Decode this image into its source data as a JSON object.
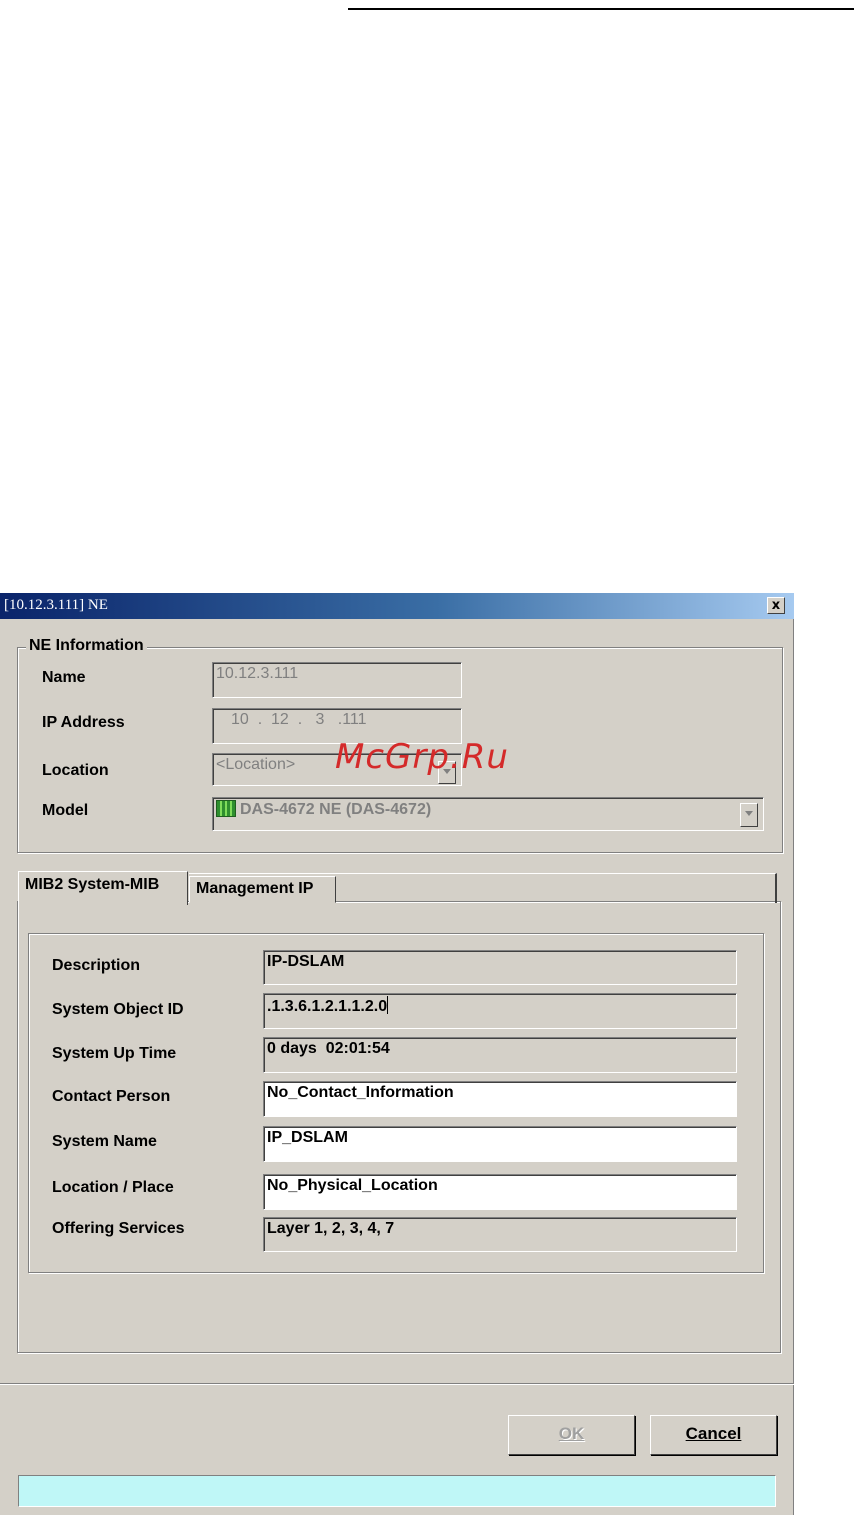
{
  "watermark": "McGrp.Ru",
  "window": {
    "title": "[10.12.3.111] NE",
    "close_label": "x"
  },
  "ne_info": {
    "legend": "NE Information",
    "name_label": "Name",
    "name_value": "10.12.3.111",
    "ip_label": "IP Address",
    "ip_octets": [
      "10",
      ".",
      "12",
      ".",
      "3",
      ".",
      "111"
    ],
    "location_label": "Location",
    "location_value": "<Location>",
    "model_label": "Model",
    "model_value": "DAS-4672 NE (DAS-4672)",
    "model_icon": "dslam-icon"
  },
  "tabs": [
    {
      "label": "MIB2 System-MIB",
      "active": true
    },
    {
      "label": "Management IP",
      "active": false
    }
  ],
  "mib": {
    "description_label": "Description",
    "description_value": "IP-DSLAM",
    "object_id_label": "System Object ID",
    "object_id_value": ".1.3.6.1.2.1.1.2.0",
    "uptime_label": "System Up Time",
    "uptime_value": "0 days  02:01:54",
    "contact_label": "Contact Person",
    "contact_value": "No_Contact_Information",
    "sysname_label": "System Name",
    "sysname_value": "IP_DSLAM",
    "location_label": "Location / Place",
    "location_value": "No_Physical_Location",
    "services_label": "Offering Services",
    "services_value": "Layer 1, 2, 3, 4, 7"
  },
  "buttons": {
    "ok": "OK",
    "cancel": "Cancel"
  },
  "status_text": ""
}
